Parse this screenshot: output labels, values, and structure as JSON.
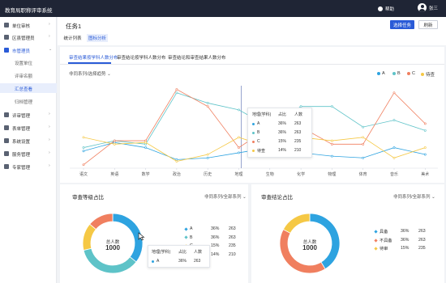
{
  "app": {
    "title": "教育局职称评审系统",
    "help": "帮助",
    "user": "张三"
  },
  "sidebar": {
    "items": [
      {
        "label": "单位审核",
        "expanded": false
      },
      {
        "label": "区县管理员",
        "expanded": false
      },
      {
        "label": "市管理员",
        "expanded": true,
        "active": true
      },
      {
        "label": "评审管理",
        "expanded": false
      },
      {
        "label": "表单管理",
        "expanded": false
      },
      {
        "label": "系统设置",
        "expanded": false
      },
      {
        "label": "服务管理",
        "expanded": false
      },
      {
        "label": "专家管理",
        "expanded": false
      }
    ],
    "subitems": [
      "设置单位",
      "评审名额",
      "汇总查看",
      "归档管理"
    ],
    "active_sub": "汇总查看"
  },
  "header": {
    "task_title": "任务1",
    "tabs": [
      "统计列表",
      "图标分析"
    ],
    "active_tab": "图标分析",
    "select_task_label": "选择任务",
    "refresh_label": "刷新"
  },
  "subtabs": {
    "items": [
      "审查结果按学科人数分布",
      "审查结论按学科人数分布",
      "审查结论和审查结果人数分布"
    ],
    "active": 0
  },
  "line_chart": {
    "filter_label": "非同系列/选择趋势",
    "legend": [
      {
        "name": "A",
        "color": "#2ea3e0"
      },
      {
        "name": "B",
        "color": "#5ec3c8"
      },
      {
        "name": "C",
        "color": "#f07f5f"
      },
      {
        "name": "待查",
        "color": "#f5c845"
      }
    ]
  },
  "chart_data": [
    {
      "type": "line",
      "categories": [
        "语文",
        "英语",
        "数学",
        "政治",
        "历史",
        "地理",
        "生物",
        "化学",
        "物理",
        "体育",
        "音乐",
        "美术"
      ],
      "series": [
        {
          "name": "A",
          "color": "#2ea3e0",
          "values": [
            50,
            75,
            60,
            25,
            30,
            45,
            60,
            45,
            35,
            30,
            60,
            40
          ]
        },
        {
          "name": "B",
          "color": "#5ec3c8",
          "values": [
            60,
            80,
            70,
            220,
            190,
            170,
            120,
            180,
            180,
            120,
            140,
            110
          ]
        },
        {
          "name": "C",
          "color": "#f07f5f",
          "values": [
            10,
            80,
            80,
            230,
            180,
            60,
            120,
            120,
            70,
            70,
            220,
            130
          ]
        },
        {
          "name": "待查",
          "color": "#f5c845",
          "values": [
            90,
            70,
            75,
            20,
            40,
            90,
            60,
            90,
            80,
            90,
            30,
            60
          ]
        }
      ],
      "ylim": [
        0,
        250
      ]
    },
    {
      "type": "pie",
      "title": "审查等级占比",
      "slices": [
        {
          "name": "A",
          "percent": 36,
          "count": 263,
          "color": "#2ea3e0"
        },
        {
          "name": "B",
          "percent": 36,
          "count": 263,
          "color": "#5ec3c8"
        },
        {
          "name": "C",
          "percent": 15,
          "count": 235,
          "color": "#f5c845"
        },
        {
          "name": "待查",
          "percent": 14,
          "count": 210,
          "color": "#f07f5f"
        }
      ]
    },
    {
      "type": "pie",
      "title": "审查结论占比",
      "slices": [
        {
          "name": "具备",
          "percent": 36,
          "count": 263,
          "color": "#2ea3e0"
        },
        {
          "name": "不具备",
          "percent": 36,
          "count": 263,
          "color": "#f07f5f"
        },
        {
          "name": "待审",
          "percent": 15,
          "count": 235,
          "color": "#f5c845"
        }
      ]
    }
  ],
  "tooltip_line": {
    "header": [
      "地理(学科)",
      "占比",
      "人数"
    ],
    "rows": [
      {
        "name": "A",
        "percent": "36%",
        "count": "263",
        "color": "#2ea3e0"
      },
      {
        "name": "B",
        "percent": "36%",
        "count": "263",
        "color": "#5ec3c8"
      },
      {
        "name": "C",
        "percent": "15%",
        "count": "235",
        "color": "#f07f5f"
      },
      {
        "name": "待查",
        "percent": "14%",
        "count": "210",
        "color": "#f5c845"
      }
    ]
  },
  "pie1": {
    "title": "审查等级占比",
    "filter": "非同系列/全部系列",
    "center_label": "总人数",
    "center_value": "1000",
    "tooltip": {
      "header": [
        "地理(学科)",
        "占比",
        "人数"
      ],
      "row": {
        "name": "A",
        "percent": "36%",
        "count": "263"
      }
    }
  },
  "pie2": {
    "title": "审查结论占比",
    "filter": "非同系列/全部系列",
    "center_label": "总人数",
    "center_value": "1000"
  }
}
